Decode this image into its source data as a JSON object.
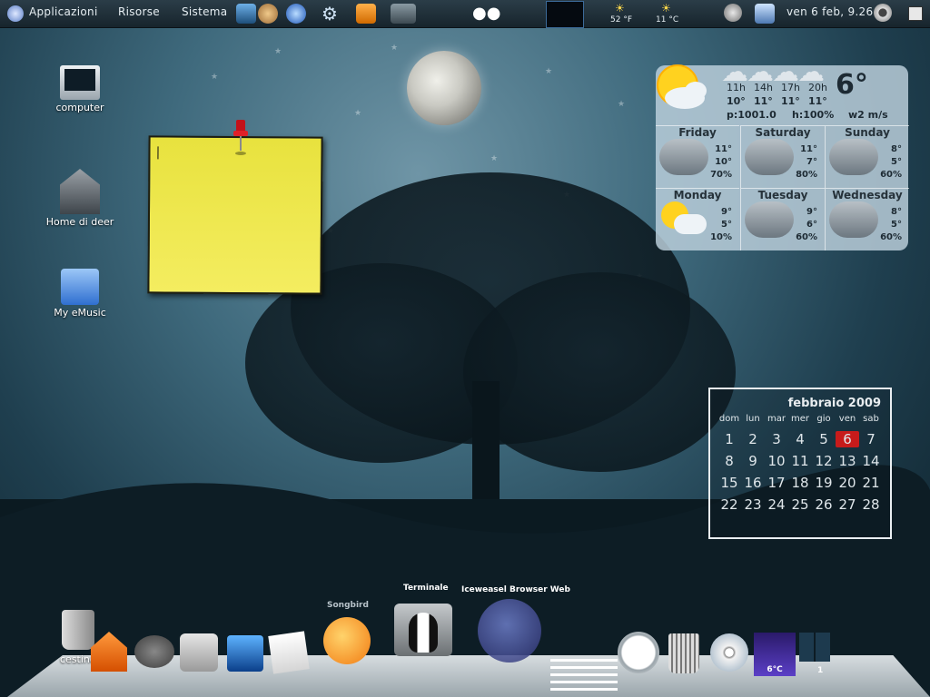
{
  "top_panel": {
    "menus": [
      "Applicazioni",
      "Risorse",
      "Sistema"
    ],
    "temp_left": "52 °F",
    "temp_right": "11 °C",
    "clock": "ven  6 feb,  9.26"
  },
  "desktop_icons": {
    "computer": "computer",
    "home": "Home di deer",
    "emusic": "My eMusic",
    "trash": "cestino"
  },
  "weather": {
    "current_temp": "6°",
    "hours": [
      "11h",
      "14h",
      "17h",
      "20h"
    ],
    "hour_temps": [
      "10°",
      "11°",
      "11°",
      "11°"
    ],
    "pressure": "p:1001.0",
    "humidity": "h:100%",
    "wind": "w2 m/s",
    "days": [
      {
        "name": "Friday",
        "high": "11°",
        "low": "10°",
        "precip": "70%"
      },
      {
        "name": "Saturday",
        "high": "11°",
        "low": "7°",
        "precip": "80%"
      },
      {
        "name": "Sunday",
        "high": "8°",
        "low": "5°",
        "precip": "60%"
      },
      {
        "name": "Monday",
        "high": "9°",
        "low": "5°",
        "precip": "10%"
      },
      {
        "name": "Tuesday",
        "high": "9°",
        "low": "6°",
        "precip": "60%"
      },
      {
        "name": "Wednesday",
        "high": "8°",
        "low": "5°",
        "precip": "60%"
      }
    ]
  },
  "calendar": {
    "title": "febbraio 2009",
    "weekdays": [
      "dom",
      "lun",
      "mar",
      "mer",
      "gio",
      "ven",
      "sab"
    ],
    "weeks": [
      [
        "1",
        "2",
        "3",
        "4",
        "5",
        "6",
        "7"
      ],
      [
        "8",
        "9",
        "10",
        "11",
        "12",
        "13",
        "14"
      ],
      [
        "15",
        "16",
        "17",
        "18",
        "19",
        "20",
        "21"
      ],
      [
        "22",
        "23",
        "24",
        "25",
        "26",
        "27",
        "28"
      ]
    ],
    "today": "6"
  },
  "dock": {
    "label_songbird": "Songbird",
    "label_terminal": "Terminale",
    "label_browser": "Iceweasel Browser Web",
    "weather_temp": "6°C",
    "workspace": "1"
  }
}
